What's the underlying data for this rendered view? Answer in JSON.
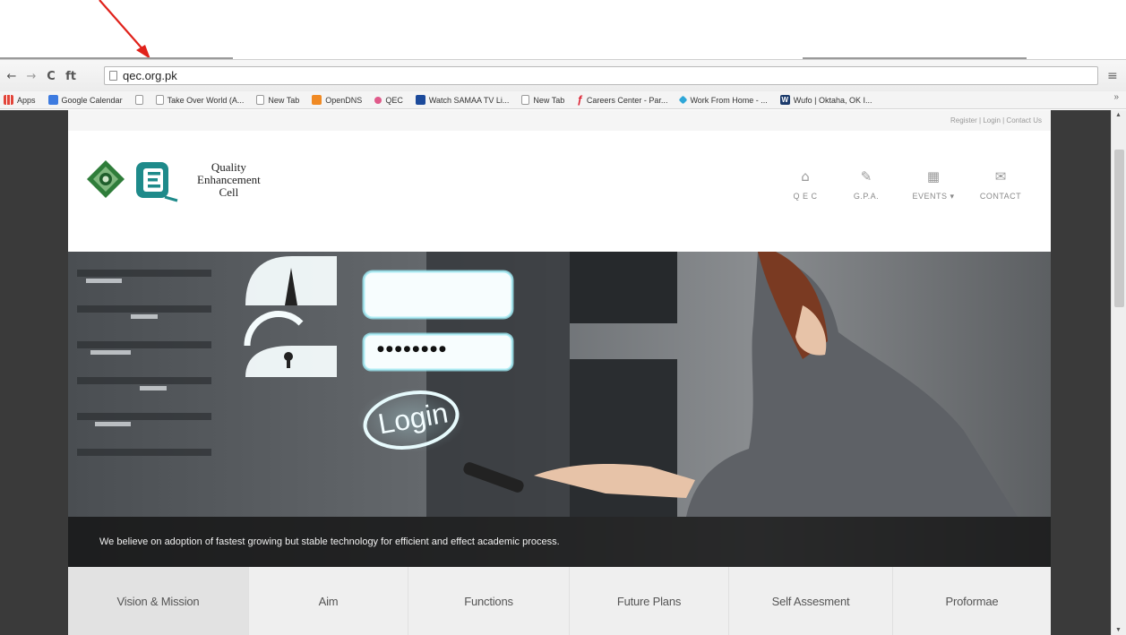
{
  "browser": {
    "url": "qec.org.pk",
    "nav_buttons": {
      "back": "←",
      "forward": "→",
      "reload": "C",
      "home": "ft"
    },
    "menu_icon": "≡",
    "bookmarks": [
      {
        "label": "Apps",
        "icon": "apps-icon"
      },
      {
        "label": "Google Calendar",
        "icon": "calendar-icon"
      },
      {
        "label": "",
        "icon": "page-icon"
      },
      {
        "label": "Take Over World (A...",
        "icon": "page-icon"
      },
      {
        "label": "New Tab",
        "icon": "page-icon"
      },
      {
        "label": "OpenDNS",
        "icon": "opendns-icon"
      },
      {
        "label": "QEC",
        "icon": "qec-icon"
      },
      {
        "label": "Watch SAMAA TV Li...",
        "icon": "samaa-icon"
      },
      {
        "label": "New Tab",
        "icon": "page-icon"
      },
      {
        "label": "Careers Center - Par...",
        "icon": "careers-icon"
      },
      {
        "label": "Work From Home - ...",
        "icon": "wfh-icon"
      },
      {
        "label": "Wufo | Oktaha, OK I...",
        "icon": "wufo-icon"
      }
    ],
    "bookmarks_more": "»"
  },
  "site": {
    "toplinks": {
      "register": "Register",
      "login": "Login",
      "contact": "Contact Us",
      "sep": " | "
    },
    "logo": {
      "line1": "Quality",
      "line2": "Enhancement",
      "line3": "Cell"
    },
    "nav": [
      {
        "label": "Q E C",
        "icon": "⌂"
      },
      {
        "label": "G.P.A.",
        "icon": "✎"
      },
      {
        "label": "EVENTS ▾",
        "icon": "▦"
      },
      {
        "label": "CONTACT",
        "icon": "✉"
      }
    ],
    "hero": {
      "login_word": "Login",
      "password_mask": "●●●●●●●●",
      "caption": "We believe on adoption of fastest growing but stable technology for efficient and effect academic process."
    },
    "tabs": [
      "Vision & Mission",
      "Aim",
      "Functions",
      "Future Plans",
      "Self Assesment",
      "Proformae"
    ]
  },
  "colors": {
    "annotation_arrow": "#e0221b",
    "logo_teal": "#1e8a8a",
    "logo_green": "#2f7d3a"
  }
}
